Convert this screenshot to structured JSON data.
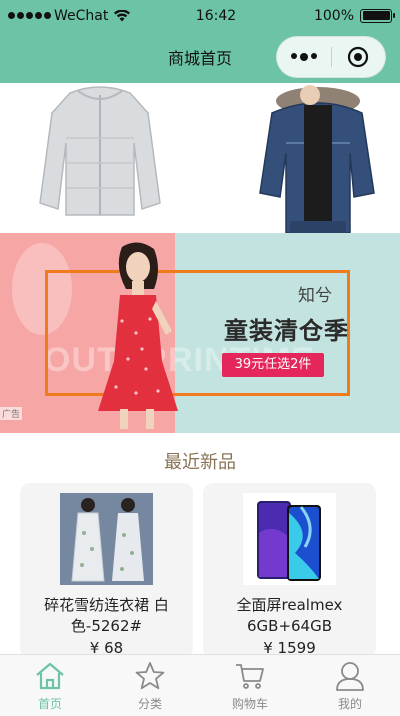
{
  "status_bar": {
    "carrier": "WeChat",
    "time": "16:42",
    "battery": "100%",
    "battery_level": 1.0
  },
  "nav": {
    "title": "商城首页",
    "more_icon": "more-dots-icon",
    "close_icon": "target-circle-icon"
  },
  "banner": {
    "brand": "知兮",
    "title": "童装清仓季",
    "promo": "39元任选2件",
    "watermark": "OUTERRINTIME",
    "ad_tag": "广告"
  },
  "section": {
    "title": "最近新品"
  },
  "products": [
    {
      "name": "碎花雪纺连衣裙 白色-5262#",
      "price": "¥ 68"
    },
    {
      "name": "全面屏realmex 6GB+64GB",
      "price": "¥ 1599"
    }
  ],
  "tabs": [
    {
      "label": "首页",
      "icon": "home-icon",
      "active": true
    },
    {
      "label": "分类",
      "icon": "star-icon",
      "active": false
    },
    {
      "label": "购物车",
      "icon": "cart-icon",
      "active": false
    },
    {
      "label": "我的",
      "icon": "user-icon",
      "active": false
    }
  ],
  "colors": {
    "accent": "#6cc3a5",
    "section_title": "#8a7355",
    "promo": "#e4265a",
    "frame": "#ef7b1c"
  }
}
